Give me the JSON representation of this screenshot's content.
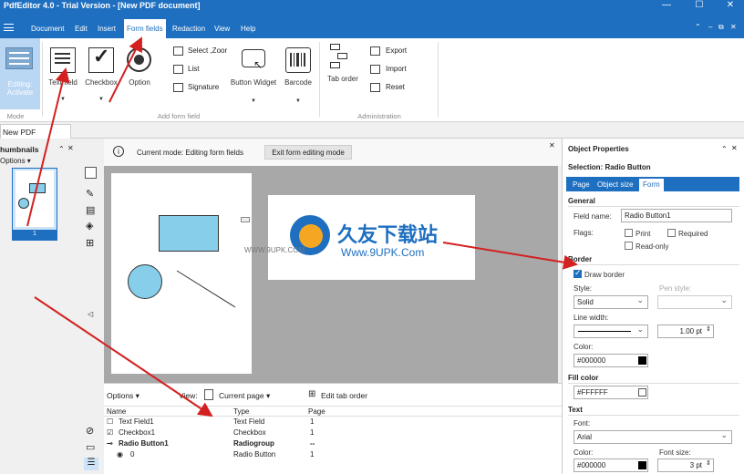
{
  "window": {
    "title": "PdfEditor 4.0 - Trial Version - [New PDF document]",
    "controls": [
      "—",
      "☐",
      "✕"
    ]
  },
  "menubar": {
    "items": [
      "Document",
      "Edit",
      "Insert",
      "Form fields",
      "Redaction",
      "View",
      "Help"
    ],
    "active": "Form fields",
    "right_controls": [
      "⌃",
      "–",
      "⧉",
      "✕"
    ]
  },
  "ribbon": {
    "mode": {
      "label": "Editing: Activate",
      "group": "Mode"
    },
    "add_form_field": {
      "group": "Add form field",
      "text_field": "Text field",
      "checkbox": "Checkbox",
      "option": "Option",
      "select_zoom": "Select ,Zoor",
      "list": "List",
      "signature": "Signature",
      "button_widget": "Button Widget",
      "barcode": "Barcode"
    },
    "administration": {
      "group": "Administration",
      "tab_order": "Tab order",
      "export": "Export",
      "import": "Import",
      "reset": "Reset"
    }
  },
  "doc_tab": {
    "label": "New PDF document",
    "close": "✕"
  },
  "thumbnails": {
    "title": "humbnails",
    "options": "Options",
    "page_number": "1"
  },
  "editor": {
    "info_icon": "i",
    "mode_text": "Current mode: Editing form fields",
    "exit_button": "Exit form editing mode",
    "watermark_text": "久友下载站",
    "watermark_url_left": "WWW.9UPK.COM",
    "watermark_url_right": "Www.9UPK.Com"
  },
  "fieldlist": {
    "options": "Options",
    "view_label": "View:",
    "view_value": "Current page",
    "edit_tab_order": "Edit tab order",
    "columns": [
      "Name",
      "Type",
      "Page"
    ],
    "rows": [
      {
        "name": "Text Field1",
        "type": "Text Field",
        "page": "1",
        "bold": false,
        "marker": "☐"
      },
      {
        "name": "Checkbox1",
        "type": "Checkbox",
        "page": "1",
        "bold": false,
        "marker": "☑"
      },
      {
        "name": "Radio Button1",
        "type": "Radiogroup",
        "page": "--",
        "bold": true,
        "marker": "⊸"
      },
      {
        "name": "0",
        "type": "Radio Button",
        "page": "1",
        "bold": false,
        "marker": "◉"
      }
    ]
  },
  "properties": {
    "title": "Object Properties",
    "selection": "Selection: Radio Button",
    "tabs": [
      "Page",
      "Object size",
      "Form"
    ],
    "active_tab": "Form",
    "general": {
      "header": "General",
      "field_name_label": "Field name:",
      "field_name": "Radio Button1",
      "flags_label": "Flags:",
      "print": "Print",
      "required": "Required",
      "read_only": "Read-only"
    },
    "border": {
      "header": "Border",
      "draw_border": "Draw border",
      "style_label": "Style:",
      "style": "Solid",
      "pen_style_label": "Pen style:",
      "line_width_label": "Line width:",
      "line_width": "1.00 pt",
      "color_label": "Color:",
      "color": "#000000"
    },
    "fill_color": {
      "header": "Fill color",
      "color": "#FFFFFF"
    },
    "text": {
      "header": "Text",
      "font_label": "Font:",
      "font": "Arial",
      "color_label": "Color:",
      "color": "#000000",
      "font_size_label": "Font size:",
      "font_size": "3 pt"
    }
  },
  "colors": {
    "accent": "#1e6fc0",
    "shape_fill": "#87ceeb",
    "arrow": "#d42020",
    "canvas_bg": "#a8a8a8"
  }
}
